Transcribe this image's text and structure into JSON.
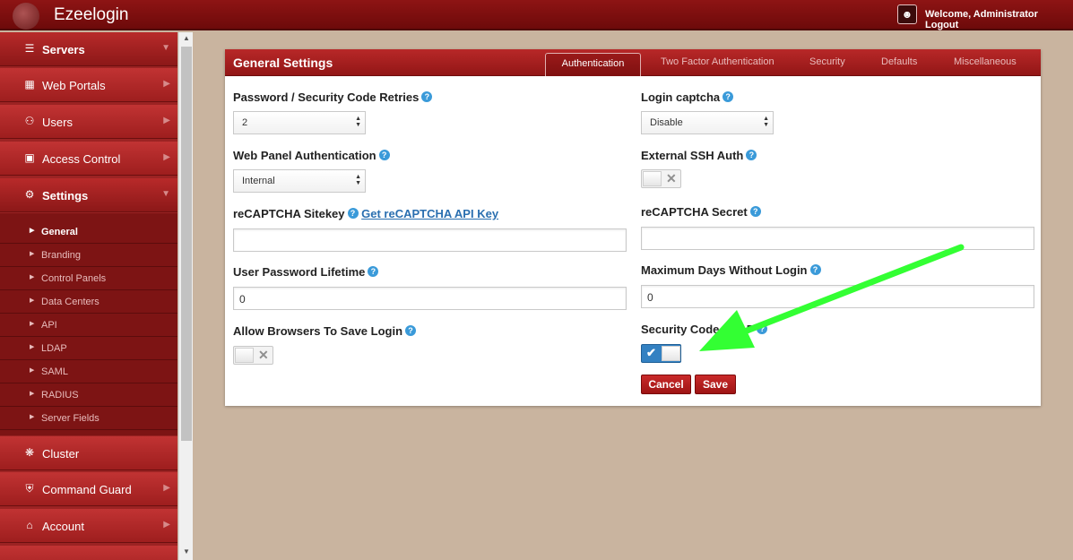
{
  "app": {
    "title": "Ezeelogin",
    "welcome": "Welcome, Administrator Logout"
  },
  "sidebar": {
    "items": [
      {
        "label": "Servers",
        "icon": "list-icon",
        "expanded": true
      },
      {
        "label": "Web Portals",
        "icon": "portal-icon"
      },
      {
        "label": "Users",
        "icon": "users-icon"
      },
      {
        "label": "Access Control",
        "icon": "lock-icon"
      },
      {
        "label": "Settings",
        "icon": "gears-icon",
        "expanded": true
      },
      {
        "label": "Cluster",
        "icon": "cluster-icon"
      },
      {
        "label": "Command Guard",
        "icon": "shield-icon"
      },
      {
        "label": "Account",
        "icon": "home-icon"
      }
    ],
    "settings_sub": [
      "General",
      "Branding",
      "Control Panels",
      "Data Centers",
      "API",
      "LDAP",
      "SAML",
      "RADIUS",
      "Server Fields"
    ]
  },
  "panel": {
    "title": "General Settings",
    "tabs": [
      "Authentication",
      "Two Factor Authentication",
      "Security",
      "Defaults",
      "Miscellaneous"
    ],
    "fields": {
      "retries_label": "Password / Security Code Retries",
      "retries_value": "2",
      "web_auth_label": "Web Panel Authentication",
      "web_auth_value": "Internal",
      "recaptcha_sitekey_label": "reCAPTCHA Sitekey",
      "recaptcha_link": "Get reCAPTCHA API Key",
      "recaptcha_sitekey_value": "",
      "pwd_lifetime_label": "User Password Lifetime",
      "pwd_lifetime_value": "0",
      "allow_browsers_label": "Allow Browsers To Save Login",
      "allow_browsers_on": false,
      "login_captcha_label": "Login captcha",
      "login_captcha_value": "Disable",
      "ext_ssh_label": "External SSH Auth",
      "ext_ssh_on": false,
      "recaptcha_secret_label": "reCAPTCHA Secret",
      "recaptcha_secret_value": "",
      "max_days_label": "Maximum Days Without Login",
      "max_days_value": "0",
      "sec_code_ldap_label": "Security Code LDAP",
      "sec_code_ldap_on": true
    },
    "buttons": {
      "cancel": "Cancel",
      "save": "Save"
    }
  },
  "colors": {
    "brand": "#a01c1c",
    "help": "#3a9ad9",
    "toggle_on": "#3381c2",
    "annotation_arrow": "#33ff33"
  }
}
